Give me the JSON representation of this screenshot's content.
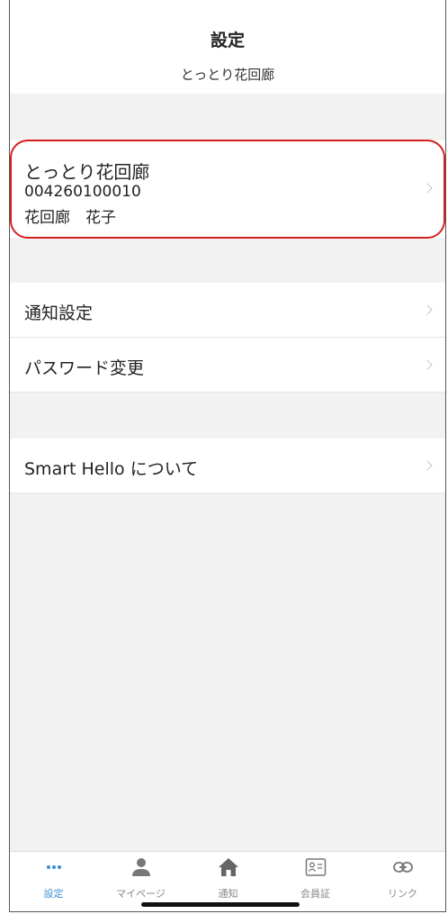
{
  "header": {
    "title": "設定",
    "subtitle": "とっとり花回廊"
  },
  "profile": {
    "name": "とっとり花回廊",
    "number": "004260100010",
    "person": "花回廊　花子"
  },
  "settings": {
    "items": [
      {
        "label": "通知設定"
      },
      {
        "label": "パスワード変更"
      }
    ]
  },
  "about": {
    "label": "Smart Hello について"
  },
  "tabbar": {
    "tabs": [
      {
        "label": "設定",
        "icon": "more-dots-icon",
        "active": true
      },
      {
        "label": "マイページ",
        "icon": "person-icon",
        "active": false
      },
      {
        "label": "通知",
        "icon": "home-icon",
        "active": false
      },
      {
        "label": "会員証",
        "icon": "member-card-icon",
        "active": false
      },
      {
        "label": "リンク",
        "icon": "link-icon",
        "active": false
      }
    ]
  },
  "colors": {
    "accent": "#3c8fd4",
    "highlight": "#d62020",
    "background": "#f2f2f2"
  }
}
